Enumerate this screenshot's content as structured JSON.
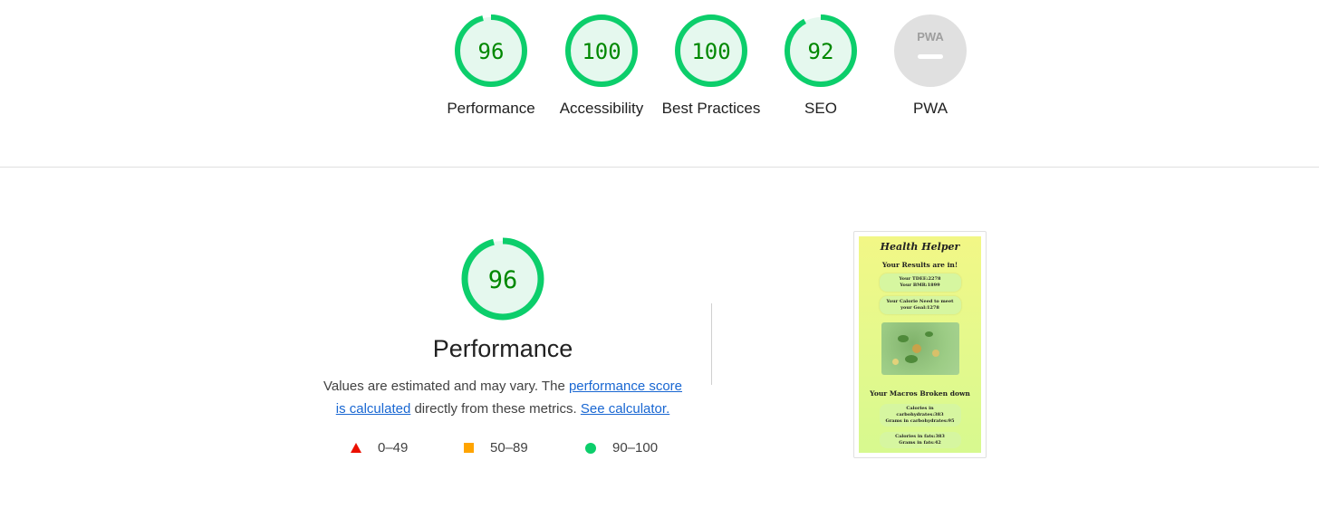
{
  "categories": [
    {
      "id": "performance",
      "score": "96",
      "score_value": 96,
      "label": "Performance"
    },
    {
      "id": "accessibility",
      "score": "100",
      "score_value": 100,
      "label": "Accessibility"
    },
    {
      "id": "best-practices",
      "score": "100",
      "score_value": 100,
      "label": "Best Practices"
    },
    {
      "id": "seo",
      "score": "92",
      "score_value": 92,
      "label": "SEO"
    },
    {
      "id": "pwa",
      "score": "",
      "badge_text": "PWA",
      "label": "PWA"
    }
  ],
  "performance": {
    "score": "96",
    "score_value": 96,
    "title": "Performance",
    "desc_prefix": "Values are estimated and may vary. The ",
    "desc_link1": "performance score is calculated",
    "desc_middle": " directly from these metrics. ",
    "desc_link2": "See calculator."
  },
  "legend": [
    {
      "range": "0–49",
      "shape": "triangle",
      "color": "#eb0f00"
    },
    {
      "range": "50–89",
      "shape": "square",
      "color": "#ffa400"
    },
    {
      "range": "90–100",
      "shape": "circle",
      "color": "#0cce6b"
    }
  ],
  "colors": {
    "pass": "#0cce6b",
    "pass_fill": "#e5f8ee",
    "pass_text": "#008800",
    "na": "#e0e0e0",
    "link": "#1967d2"
  },
  "thumbnail": {
    "app_title": "Health Helper",
    "subtitle": "Your Results are in!",
    "tdee": "Your TDEE:2278",
    "bmr": "Your BMR:1899",
    "calorie_need": "Your Calorie Need to meet your Goal:1278",
    "macros_heading": "Your Macros Broken down",
    "carbs_cal": "Calories in carbohydrates:383",
    "carbs_grams": "Grams in carbohydrates:95",
    "fats_cal": "Calories in fats:383",
    "fats_grams": "Grams in fats:42"
  }
}
